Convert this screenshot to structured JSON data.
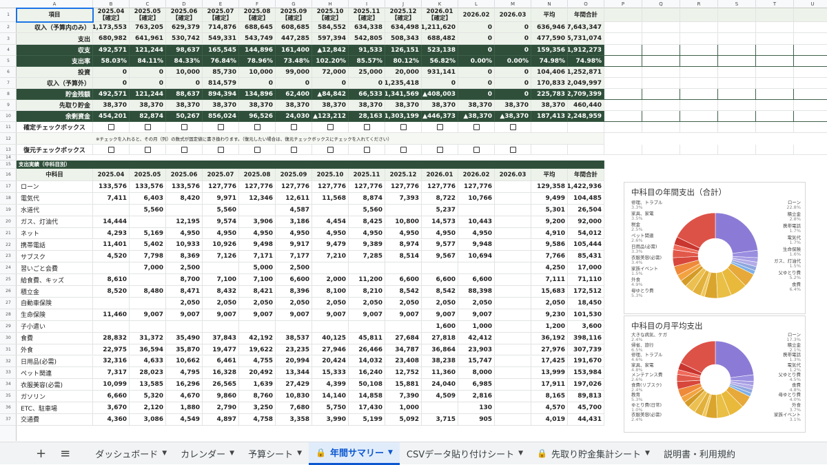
{
  "columns": [
    "A",
    "B",
    "C",
    "D",
    "E",
    "F",
    "G",
    "H",
    "I",
    "J",
    "K",
    "L",
    "M",
    "N",
    "O",
    "P",
    "Q",
    "R",
    "S",
    "T",
    "U",
    "V",
    "W"
  ],
  "rows": [
    "1",
    "2",
    "3",
    "4",
    "5",
    "6",
    "7",
    "8",
    "9",
    "10",
    "11",
    "12",
    "13",
    "14",
    "15",
    "16",
    "17",
    "18",
    "19",
    "20",
    "21",
    "22",
    "23",
    "24",
    "25",
    "26",
    "27",
    "28",
    "29",
    "30",
    "31",
    "32",
    "33",
    "34",
    "35",
    "36",
    "37"
  ],
  "summary": {
    "header": [
      "項目",
      "2025.04\n【確定】",
      "2025.05\n【確定】",
      "2025.06\n【確定】",
      "2025.07\n【確定】",
      "2025.08\n【確定】",
      "2025.09\n【確定】",
      "2025.10\n【確定】",
      "2025.11\n【確定】",
      "2025.12\n【確定】",
      "2026.01\n【確定】",
      "2026.02",
      "2026.03",
      "平均",
      "年間合計"
    ],
    "rows": [
      {
        "label": "収入（予算内のみ）",
        "style": "lt",
        "vals": [
          "1,173,553",
          "763,205",
          "629,379",
          "714,876",
          "688,645",
          "608,685",
          "584,552",
          "634,338",
          "634,498",
          "1,211,620",
          "0",
          "0",
          "636,946",
          "7,643,347"
        ]
      },
      {
        "label": "支出",
        "style": "lt",
        "vals": [
          "680,982",
          "641,961",
          "530,742",
          "549,331",
          "543,749",
          "447,285",
          "597,394",
          "542,805",
          "508,343",
          "688,482",
          "0",
          "0",
          "477,590",
          "5,731,074"
        ]
      },
      {
        "label": "収支",
        "style": "dk",
        "vals": [
          "492,571",
          "121,244",
          "98,637",
          "165,545",
          "144,896",
          "161,400",
          "▲12,842",
          "91,533",
          "126,151",
          "523,138",
          "0",
          "0",
          "159,356",
          "1,912,273"
        ]
      },
      {
        "label": "支出率",
        "style": "dk",
        "vals": [
          "58.03%",
          "84.11%",
          "84.33%",
          "76.84%",
          "78.96%",
          "73.48%",
          "102.20%",
          "85.57%",
          "80.12%",
          "56.82%",
          "0.00%",
          "0.00%",
          "74.98%",
          "74.98%"
        ]
      },
      {
        "label": "投資",
        "style": "lt",
        "vals": [
          "0",
          "0",
          "10,000",
          "85,730",
          "10,000",
          "99,000",
          "72,000",
          "25,000",
          "20,000",
          "931,141",
          "0",
          "0",
          "104,406",
          "1,252,871"
        ]
      },
      {
        "label": "収入（予算外）",
        "style": "lt",
        "vals": [
          "0",
          "0",
          "0",
          "814,579",
          "0",
          "0",
          "0",
          "0",
          "1,235,418",
          "0",
          "0",
          "0",
          "170,833",
          "2,049,997"
        ]
      },
      {
        "label": "貯金残額",
        "style": "dk",
        "vals": [
          "492,571",
          "121,244",
          "88,637",
          "894,394",
          "134,896",
          "62,400",
          "▲84,842",
          "66,533",
          "1,341,569",
          "▲408,003",
          "0",
          "0",
          "225,783",
          "2,709,399"
        ]
      },
      {
        "label": "先取り貯金",
        "style": "lt",
        "vals": [
          "38,370",
          "38,370",
          "38,370",
          "38,370",
          "38,370",
          "38,370",
          "38,370",
          "38,370",
          "38,370",
          "38,370",
          "38,370",
          "38,370",
          "38,370",
          "460,440"
        ]
      },
      {
        "label": "余剰資金",
        "style": "dk",
        "vals": [
          "454,201",
          "82,874",
          "50,267",
          "856,024",
          "96,526",
          "24,030",
          "▲123,212",
          "28,163",
          "1,303,199",
          "▲446,373",
          "▲38,370",
          "▲38,370",
          "187,413",
          "2,248,959"
        ]
      }
    ],
    "confirm_label": "確定チェックボックス",
    "note": "※チェックを入れると、その月（列）の数式が固定値に書き換わります。（復元したい場合は、復元チェックボックスにチェックを入れてください）",
    "restore_label": "復元チェックボックス"
  },
  "detail": {
    "section_title": "支出実績（中科目別）",
    "header": [
      "中科目",
      "2025.04",
      "2025.05",
      "2025.06",
      "2025.07",
      "2025.08",
      "2025.09",
      "2025.10",
      "2025.11",
      "2025.12",
      "2026.01",
      "2026.02",
      "2026.03",
      "平均",
      "年間合計"
    ],
    "rows": [
      {
        "label": "ローン",
        "vals": [
          "133,576",
          "133,576",
          "133,576",
          "127,776",
          "127,776",
          "127,776",
          "127,776",
          "127,776",
          "127,776",
          "127,776",
          "127,776",
          "",
          "129,358",
          "1,422,936"
        ]
      },
      {
        "label": "電気代",
        "vals": [
          "7,411",
          "6,403",
          "8,420",
          "9,971",
          "12,346",
          "12,611",
          "11,568",
          "8,874",
          "7,393",
          "8,722",
          "10,766",
          "",
          "9,499",
          "104,485"
        ]
      },
      {
        "label": "水道代",
        "vals": [
          "",
          "5,560",
          "",
          "5,560",
          "",
          "4,587",
          "",
          "5,560",
          "",
          "5,237",
          "",
          "",
          "5,301",
          "26,504"
        ]
      },
      {
        "label": "ガス、灯油代",
        "vals": [
          "14,444",
          "",
          "12,195",
          "9,574",
          "3,906",
          "3,186",
          "4,454",
          "8,425",
          "10,800",
          "14,573",
          "10,443",
          "",
          "9,200",
          "92,000"
        ]
      },
      {
        "label": "ネット",
        "vals": [
          "4,293",
          "5,169",
          "4,950",
          "4,950",
          "4,950",
          "4,950",
          "4,950",
          "4,950",
          "4,950",
          "4,950",
          "4,950",
          "",
          "4,910",
          "54,012"
        ]
      },
      {
        "label": "携帯電話",
        "vals": [
          "11,401",
          "5,402",
          "10,933",
          "10,926",
          "9,498",
          "9,917",
          "9,479",
          "9,389",
          "8,974",
          "9,577",
          "9,948",
          "",
          "9,586",
          "105,444"
        ]
      },
      {
        "label": "サブスク",
        "vals": [
          "4,520",
          "7,798",
          "8,369",
          "7,126",
          "7,171",
          "7,177",
          "7,210",
          "7,285",
          "8,514",
          "9,567",
          "10,694",
          "",
          "7,766",
          "85,431"
        ]
      },
      {
        "label": "習いごと会費",
        "vals": [
          "",
          "7,000",
          "2,500",
          "",
          "5,000",
          "2,500",
          "",
          "",
          "",
          "",
          "",
          "",
          "4,250",
          "17,000"
        ]
      },
      {
        "label": "給食費、キッズ",
        "vals": [
          "8,610",
          "",
          "8,700",
          "7,100",
          "7,100",
          "6,600",
          "2,000",
          "11,200",
          "6,600",
          "6,600",
          "6,600",
          "",
          "7,111",
          "71,110"
        ]
      },
      {
        "label": "積立金",
        "vals": [
          "8,520",
          "8,480",
          "8,471",
          "8,432",
          "8,421",
          "8,396",
          "8,100",
          "8,210",
          "8,542",
          "8,542",
          "88,398",
          "",
          "15,683",
          "172,512"
        ]
      },
      {
        "label": "自動車保険",
        "vals": [
          "",
          "",
          "2,050",
          "2,050",
          "2,050",
          "2,050",
          "2,050",
          "2,050",
          "2,050",
          "2,050",
          "2,050",
          "",
          "2,050",
          "18,450"
        ]
      },
      {
        "label": "生命保険",
        "vals": [
          "11,460",
          "9,007",
          "9,007",
          "9,007",
          "9,007",
          "9,007",
          "9,007",
          "9,007",
          "9,007",
          "9,007",
          "9,007",
          "",
          "9,230",
          "101,530"
        ]
      },
      {
        "label": "子小遣い",
        "vals": [
          "",
          "",
          "",
          "",
          "",
          "",
          "",
          "",
          "",
          "1,600",
          "1,000",
          "",
          "1,200",
          "3,600"
        ]
      },
      {
        "label": "食費",
        "vals": [
          "28,832",
          "31,372",
          "35,490",
          "37,843",
          "42,192",
          "38,537",
          "40,125",
          "45,811",
          "27,684",
          "27,818",
          "42,412",
          "",
          "36,192",
          "398,116"
        ]
      },
      {
        "label": "外食",
        "vals": [
          "22,975",
          "36,594",
          "35,870",
          "19,477",
          "19,622",
          "23,235",
          "27,946",
          "26,466",
          "34,787",
          "36,864",
          "23,903",
          "",
          "27,976",
          "307,739"
        ]
      },
      {
        "label": "日用品(必需)",
        "vals": [
          "32,316",
          "4,633",
          "10,662",
          "6,461",
          "4,755",
          "20,994",
          "20,424",
          "14,032",
          "23,408",
          "38,238",
          "15,747",
          "",
          "17,425",
          "191,670"
        ]
      },
      {
        "label": "ペット関連",
        "vals": [
          "7,317",
          "28,023",
          "4,795",
          "16,328",
          "20,492",
          "13,344",
          "15,333",
          "16,240",
          "12,752",
          "11,360",
          "8,000",
          "",
          "13,999",
          "153,984"
        ]
      },
      {
        "label": "衣服美容(必需)",
        "vals": [
          "10,099",
          "13,585",
          "16,296",
          "26,565",
          "1,639",
          "27,429",
          "4,399",
          "50,108",
          "15,881",
          "24,040",
          "6,985",
          "",
          "17,911",
          "197,026"
        ]
      },
      {
        "label": "ガソリン",
        "vals": [
          "6,660",
          "5,320",
          "4,670",
          "9,860",
          "8,760",
          "10,830",
          "14,140",
          "14,858",
          "7,390",
          "4,509",
          "2,816",
          "",
          "8,165",
          "89,813"
        ]
      },
      {
        "label": "ETC、駐車場",
        "vals": [
          "3,670",
          "2,120",
          "1,880",
          "2,790",
          "3,250",
          "7,680",
          "5,750",
          "17,430",
          "1,000",
          "",
          "130",
          "",
          "4,570",
          "45,700"
        ]
      },
      {
        "label": "交通費",
        "vals": [
          "4,360",
          "3,086",
          "4,549",
          "4,897",
          "4,758",
          "3,358",
          "3,990",
          "5,199",
          "5,092",
          "3,715",
          "905",
          "",
          "4,019",
          "44,431"
        ]
      }
    ]
  },
  "chart1": {
    "title": "中科目の年間支出（合計）",
    "labels_left": [
      {
        "t": "修理、トラブル",
        "p": "3.3%"
      },
      {
        "t": "家具、家電",
        "p": "3.5%"
      },
      {
        "t": "税金",
        "p": "2.5%"
      },
      {
        "t": "ペット関連",
        "p": "2.6%"
      },
      {
        "t": "日用品(必需)",
        "p": "3.3%"
      },
      {
        "t": "衣服美容(必需)",
        "p": "3.4%"
      },
      {
        "t": "家族イベント",
        "p": "1.5%"
      },
      {
        "t": "外食",
        "p": "4.9%"
      },
      {
        "t": "母ゆとり費",
        "p": "5.3%"
      }
    ],
    "labels_right": [
      {
        "t": "ローン",
        "p": "22.8%"
      },
      {
        "t": "積立金",
        "p": "2.8%"
      },
      {
        "t": "携帯電話",
        "p": "1.7%"
      },
      {
        "t": "電気代",
        "p": "1.7%"
      },
      {
        "t": "生命保険",
        "p": "1.6%"
      },
      {
        "t": "ガス、灯油代",
        "p": "1.5%"
      },
      {
        "t": "父ゆとり費",
        "p": "5.2%"
      },
      {
        "t": "食費",
        "p": "6.4%"
      }
    ]
  },
  "chart2": {
    "title": "中科目の月平均支出",
    "labels_left": [
      {
        "t": "大きな病気、ケガ",
        "p": "2.4%"
      },
      {
        "t": "帰省、旅行",
        "p": "6.5%"
      },
      {
        "t": "修理、トラブル",
        "p": "4.6%"
      },
      {
        "t": "家具、家電",
        "p": "4.8%"
      },
      {
        "t": "メンテナンス費",
        "p": "2.6%"
      },
      {
        "t": "食費(リブスク)",
        "p": "2.4%"
      },
      {
        "t": "教育",
        "p": "5.3%"
      },
      {
        "t": "ゆとり費(日常)",
        "p": "1.0%"
      },
      {
        "t": "衣服美容(必需)",
        "p": "2.4%"
      }
    ],
    "labels_right": [
      {
        "t": "ローン",
        "p": "17.3%"
      },
      {
        "t": "積立金",
        "p": "2.1%"
      },
      {
        "t": "携帯電話",
        "p": "1.3%"
      },
      {
        "t": "電気代",
        "p": "1.2%"
      },
      {
        "t": "父ゆとり費",
        "p": "4.5%"
      },
      {
        "t": "食費",
        "p": "4.8%"
      },
      {
        "t": "母ゆとり費",
        "p": "4.0%"
      },
      {
        "t": "外食",
        "p": "3.7%"
      },
      {
        "t": "家族イベント",
        "p": "3.1%"
      }
    ]
  },
  "tabs": [
    {
      "label": "ダッシュボード",
      "lock": false,
      "active": false
    },
    {
      "label": "カレンダー",
      "lock": false,
      "active": false
    },
    {
      "label": "予算シート",
      "lock": false,
      "active": false
    },
    {
      "label": "年間サマリー",
      "lock": true,
      "active": true
    },
    {
      "label": "CSVデータ貼り付けシート",
      "lock": false,
      "active": false
    },
    {
      "label": "先取り貯金集計シート",
      "lock": true,
      "active": false
    },
    {
      "label": "説明書・利用規約",
      "lock": false,
      "active": false
    }
  ],
  "colors": {
    "dark": "#2f4f3a",
    "light": "#edf3ea",
    "purple": "#8c7bd6",
    "orange": "#e8b93b",
    "red": "#d8473b",
    "accent": "#0b57d0"
  }
}
